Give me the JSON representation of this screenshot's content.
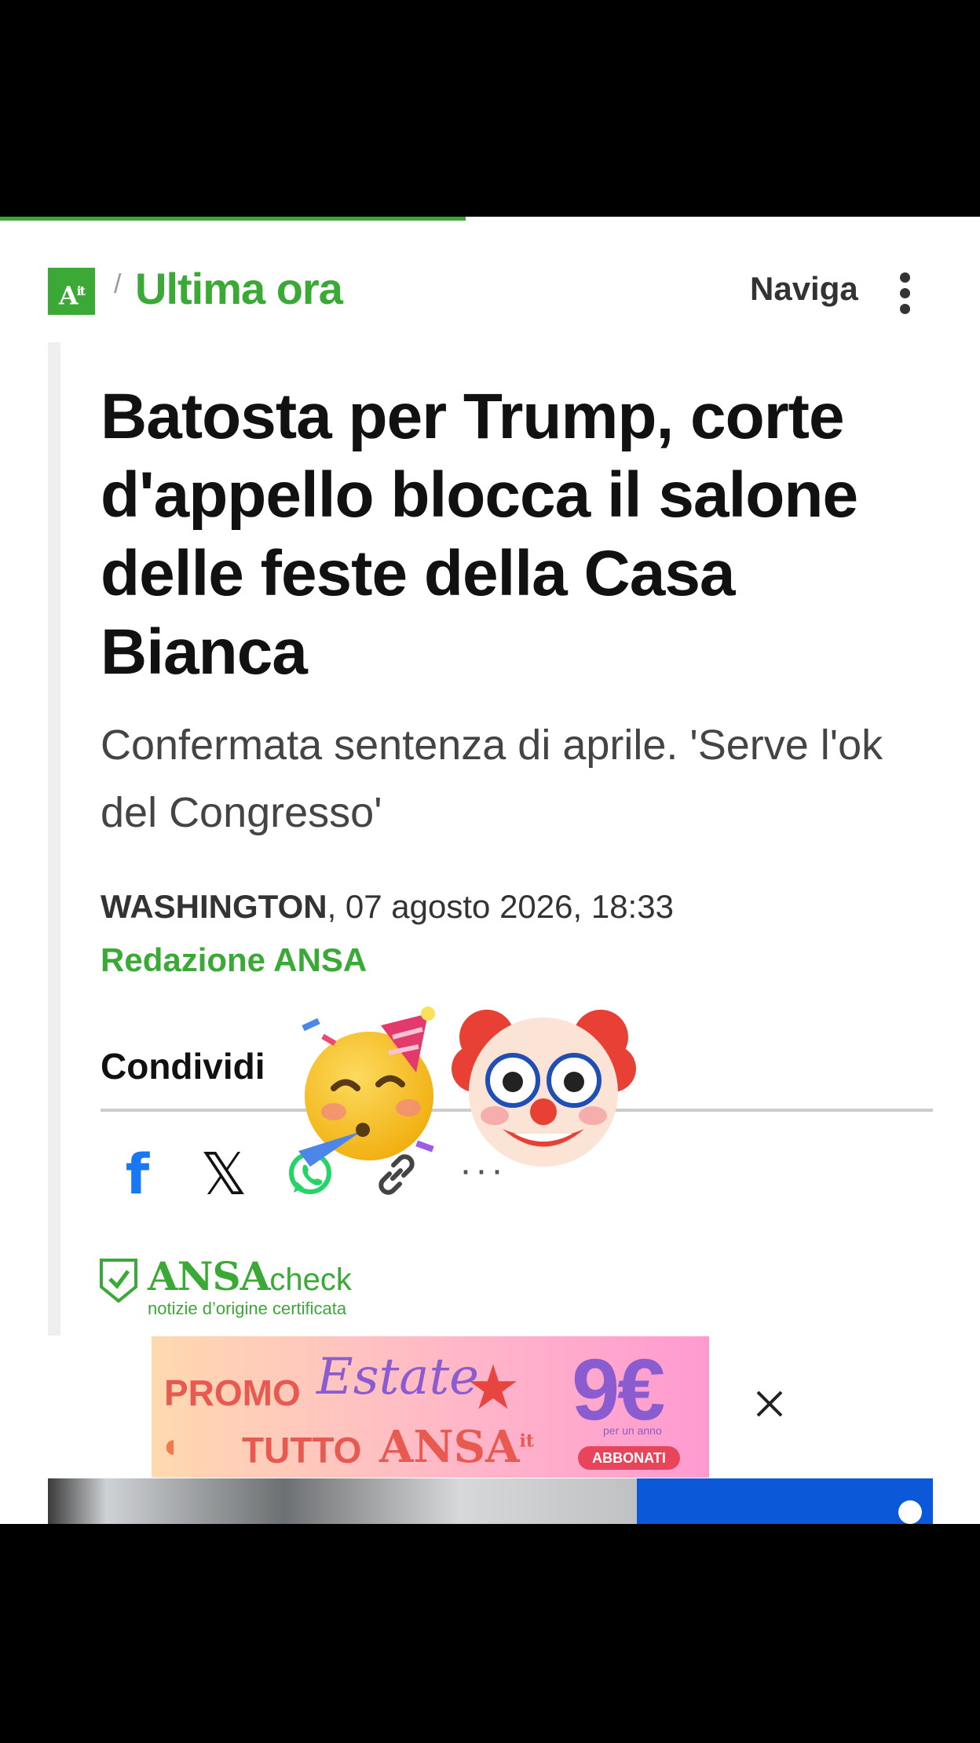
{
  "progress": {
    "percent": 47.5,
    "color": "#3aa935"
  },
  "header": {
    "logo_text": "A",
    "logo_sub": "it",
    "crumb_separator": "/",
    "section": "Ultima ora",
    "nav_label": "Naviga"
  },
  "article": {
    "headline": "Batosta per Trump, corte d'appello blocca il salone delle feste della Casa Bianca",
    "subtitle": "Confermata sentenza di aprile. 'Serve l'ok del Congresso'",
    "location": "WASHINGTON",
    "date": ", 07 agosto 2026, 18:33",
    "author": "Redazione ANSA"
  },
  "share": {
    "label": "Condividi",
    "facebook_glyph": "f",
    "x_glyph": "𝕏",
    "more_glyph": "···"
  },
  "ansa_check": {
    "brand": "ANSA",
    "suffix": "check",
    "tagline": "notizie d’origine certificata"
  },
  "overlay_emojis": [
    "partying-face",
    "clown-face"
  ],
  "promo": {
    "line1_a": "PROMO",
    "line1_b": "Estate",
    "price": "9€",
    "line2_a": "TUTTO",
    "line2_b": "ANSA",
    "line2_sup": "it",
    "per_year": "per un anno",
    "cta": "ABBONATI"
  },
  "colors": {
    "brand_green": "#3aa935",
    "facebook": "#1877f2",
    "whatsapp": "#25d366"
  }
}
